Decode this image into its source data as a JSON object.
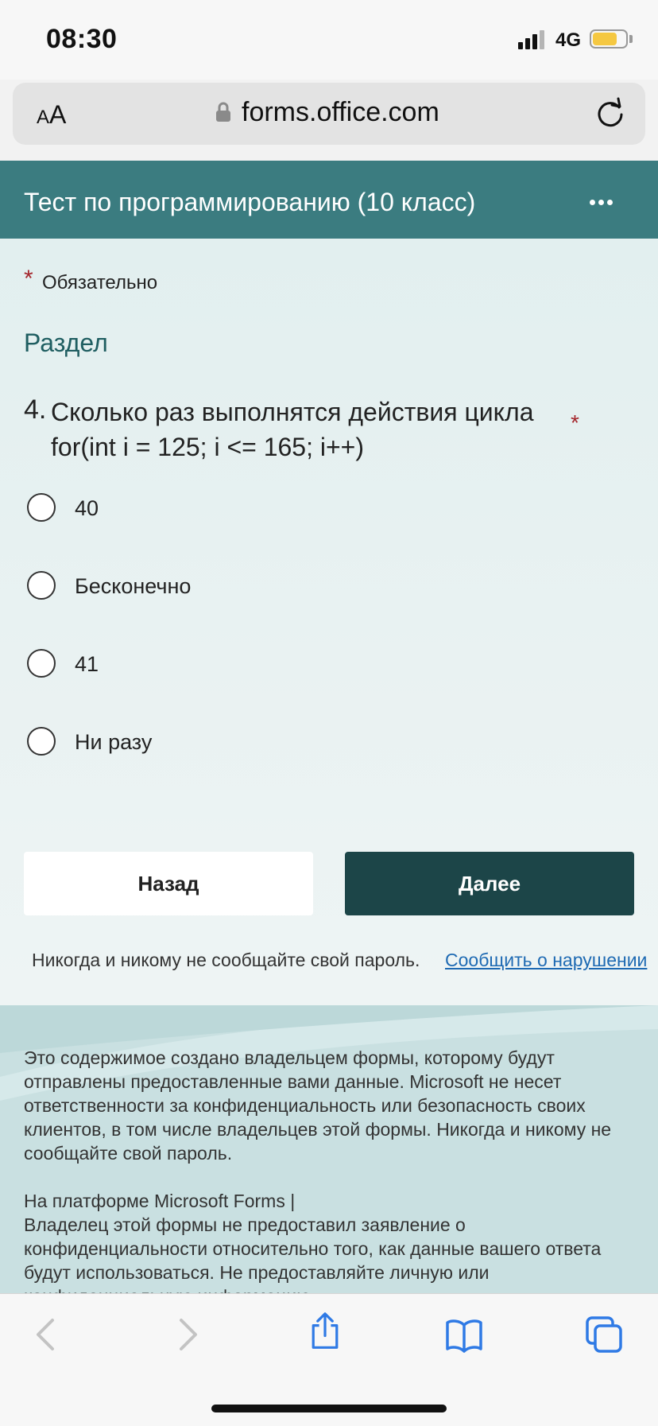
{
  "status_bar": {
    "time": "08:30",
    "network": "4G",
    "battery_level": 0.75,
    "battery_color": "#f5c842"
  },
  "browser": {
    "text_size_button_small": "A",
    "text_size_button_big": "A",
    "url": "forms.office.com",
    "lock_icon": "lock-icon",
    "reload_icon": "reload-icon"
  },
  "form": {
    "title": "Тест по программированию (10 класс)",
    "header_color": "#3b7c80",
    "more_icon": "more-horizontal-icon",
    "required_star": "*",
    "required_label": "Обязательно",
    "section_title": "Раздел",
    "question": {
      "number": "4.",
      "text_line1": "Сколько раз выполнятся действия цикла",
      "text_line2": "for(int i = 125; i <= 165; i++)",
      "required_star": "*",
      "options": [
        {
          "label": "40"
        },
        {
          "label": "Бесконечно"
        },
        {
          "label": "41"
        },
        {
          "label": "Ни разу"
        }
      ]
    },
    "back_label": "Назад",
    "next_label": "Далее",
    "next_color": "#1c4548",
    "password_note": "Никогда и никому не сообщайте свой пароль.",
    "report_link": "Сообщить о нарушении"
  },
  "footer": {
    "disclaimer": "Это содержимое создано владельцем формы, которому будут отправлены предоставленные вами данные. Microsoft не несет ответственности за конфиденциальность или безопасность своих клиентов, в том числе владельцев этой формы. Никогда и никому не сообщайте свой пароль.",
    "platform_line": "На платформе Microsoft Forms |",
    "privacy_note": "Владелец этой формы не предоставил заявление о конфиденциальности относительно того, как данные вашего ответа будут использоваться. Не предоставляйте личную или конфиденциальную информацию."
  },
  "toolbar": {
    "icons": [
      "back-arrow-icon",
      "forward-arrow-icon",
      "share-icon",
      "bookmarks-icon",
      "tabs-icon"
    ]
  }
}
